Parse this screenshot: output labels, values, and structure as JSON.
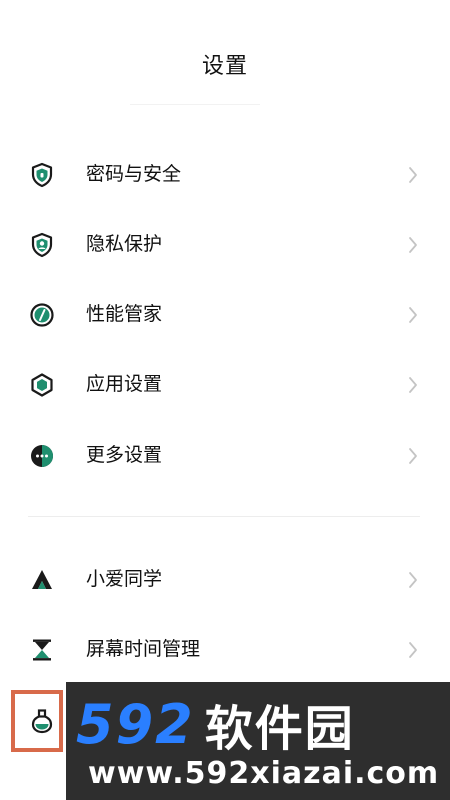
{
  "header": {
    "title": "设置"
  },
  "menu": {
    "items": [
      {
        "label": "密码与安全",
        "icon": "shield-lock-icon"
      },
      {
        "label": "隐私保护",
        "icon": "privacy-shield-icon"
      },
      {
        "label": "性能管家",
        "icon": "performance-gauge-icon"
      },
      {
        "label": "应用设置",
        "icon": "hexagon-app-icon"
      },
      {
        "label": "更多设置",
        "icon": "more-dots-circle-icon"
      },
      {
        "label": "小爱同学",
        "icon": "xiaoai-assistant-icon"
      },
      {
        "label": "屏幕时间管理",
        "icon": "hourglass-icon"
      },
      {
        "label": "",
        "icon": "flask-icon"
      }
    ]
  },
  "watermark": {
    "brand_number": "592",
    "brand_text": "软件园",
    "url": "www.592xiazai.com"
  },
  "colors": {
    "accent": "#1f8f6f",
    "dark": "#1a1a1a",
    "chevron": "#c4c4c4",
    "highlight": "#d86a4a",
    "watermark_bg": "#2e2e2e",
    "watermark_blue": "#2a7fff"
  }
}
